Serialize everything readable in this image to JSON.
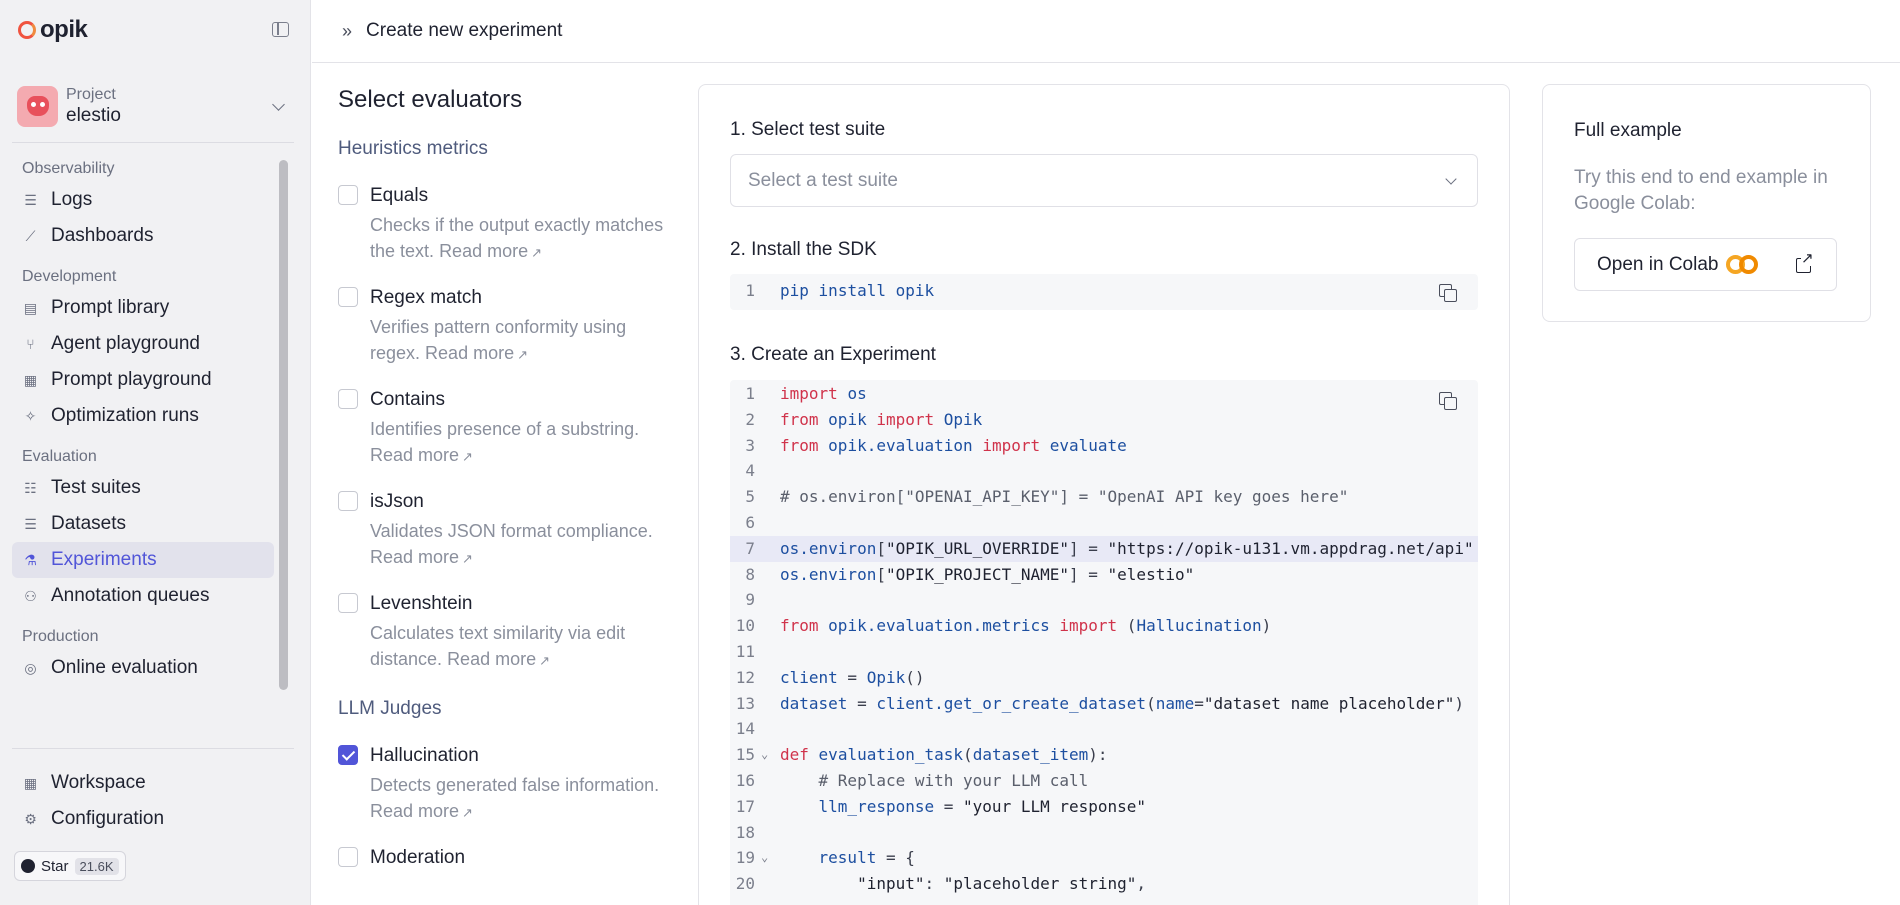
{
  "app": {
    "name": "opik"
  },
  "project": {
    "label": "Project",
    "name": "elestio"
  },
  "nav": {
    "sections": [
      {
        "title": "Observability",
        "items": [
          {
            "label": "Logs",
            "icon": "logs-icon",
            "glyph": "☰"
          },
          {
            "label": "Dashboards",
            "icon": "dashboards-icon",
            "glyph": "⟋"
          }
        ]
      },
      {
        "title": "Development",
        "items": [
          {
            "label": "Prompt library",
            "icon": "prompt-library-icon",
            "glyph": "▤"
          },
          {
            "label": "Agent playground",
            "icon": "agent-playground-icon",
            "glyph": "⑂"
          },
          {
            "label": "Prompt playground",
            "icon": "prompt-playground-icon",
            "glyph": "▦"
          },
          {
            "label": "Optimization runs",
            "icon": "optimization-runs-icon",
            "glyph": "✧"
          }
        ]
      },
      {
        "title": "Evaluation",
        "items": [
          {
            "label": "Test suites",
            "icon": "test-suites-icon",
            "glyph": "☷"
          },
          {
            "label": "Datasets",
            "icon": "datasets-icon",
            "glyph": "☰"
          },
          {
            "label": "Experiments",
            "icon": "experiments-icon",
            "glyph": "⚗",
            "active": true
          },
          {
            "label": "Annotation queues",
            "icon": "annotation-queues-icon",
            "glyph": "⚇"
          }
        ]
      },
      {
        "title": "Production",
        "items": [
          {
            "label": "Online evaluation",
            "icon": "online-evaluation-icon",
            "glyph": "◎"
          }
        ]
      }
    ],
    "bottom": [
      {
        "label": "Workspace",
        "icon": "workspace-icon",
        "glyph": "▦"
      },
      {
        "label": "Configuration",
        "icon": "configuration-icon",
        "glyph": "⚙"
      }
    ],
    "star": {
      "label": "Star",
      "count": "21.6K"
    }
  },
  "header": {
    "title": "Create new experiment"
  },
  "evaluators": {
    "title": "Select evaluators",
    "heuristics_title": "Heuristics metrics",
    "heuristics": [
      {
        "name": "Equals",
        "desc": "Checks if the output exactly matches the text.",
        "link": "Read more",
        "checked": false
      },
      {
        "name": "Regex match",
        "desc": "Verifies pattern conformity using regex.",
        "link": "Read more",
        "checked": false
      },
      {
        "name": "Contains",
        "desc": "Identifies presence of a substring.",
        "link": "Read more",
        "checked": false
      },
      {
        "name": "isJson",
        "desc": "Validates JSON format compliance.",
        "link": "Read more",
        "checked": false
      },
      {
        "name": "Levenshtein",
        "desc": "Calculates text similarity via edit distance.",
        "link": "Read more",
        "checked": false
      }
    ],
    "llm_title": "LLM Judges",
    "llm": [
      {
        "name": "Hallucination",
        "desc": "Detects generated false information.",
        "link": "Read more",
        "checked": true
      },
      {
        "name": "Moderation",
        "desc": "",
        "link": "",
        "checked": false
      }
    ]
  },
  "steps": {
    "step1": "1. Select test suite",
    "select_placeholder": "Select a test suite",
    "step2": "2. Install the SDK",
    "install_code": [
      {
        "n": "1",
        "code": "pip install opik"
      }
    ],
    "step3": "3. Create an Experiment",
    "experiment_code": [
      {
        "n": "1",
        "code": "import os"
      },
      {
        "n": "2",
        "code": "from opik import Opik"
      },
      {
        "n": "3",
        "code": "from opik.evaluation import evaluate"
      },
      {
        "n": "4",
        "code": ""
      },
      {
        "n": "5",
        "code": "# os.environ[\"OPENAI_API_KEY\"] = \"OpenAI API key goes here\""
      },
      {
        "n": "6",
        "code": ""
      },
      {
        "n": "7",
        "code": "os.environ[\"OPIK_URL_OVERRIDE\"] = \"https://opik-u131.vm.appdrag.net/api\"",
        "highlight": true
      },
      {
        "n": "8",
        "code": "os.environ[\"OPIK_PROJECT_NAME\"] = \"elestio\""
      },
      {
        "n": "9",
        "code": ""
      },
      {
        "n": "10",
        "code": "from opik.evaluation.metrics import (Hallucination)"
      },
      {
        "n": "11",
        "code": ""
      },
      {
        "n": "12",
        "code": "client = Opik()"
      },
      {
        "n": "13",
        "code": "dataset = client.get_or_create_dataset(name=\"dataset name placeholder\")"
      },
      {
        "n": "14",
        "code": ""
      },
      {
        "n": "15",
        "code": "def evaluation_task(dataset_item):",
        "fold": true
      },
      {
        "n": "16",
        "code": "    # Replace with your LLM call"
      },
      {
        "n": "17",
        "code": "    llm_response = \"your LLM response\""
      },
      {
        "n": "18",
        "code": ""
      },
      {
        "n": "19",
        "code": "    result = {",
        "fold": true
      },
      {
        "n": "20",
        "code": "        \"input\": \"placeholder string\","
      }
    ]
  },
  "full_example": {
    "title": "Full example",
    "desc": "Try this end to end example in Google Colab:",
    "button": "Open in Colab"
  }
}
